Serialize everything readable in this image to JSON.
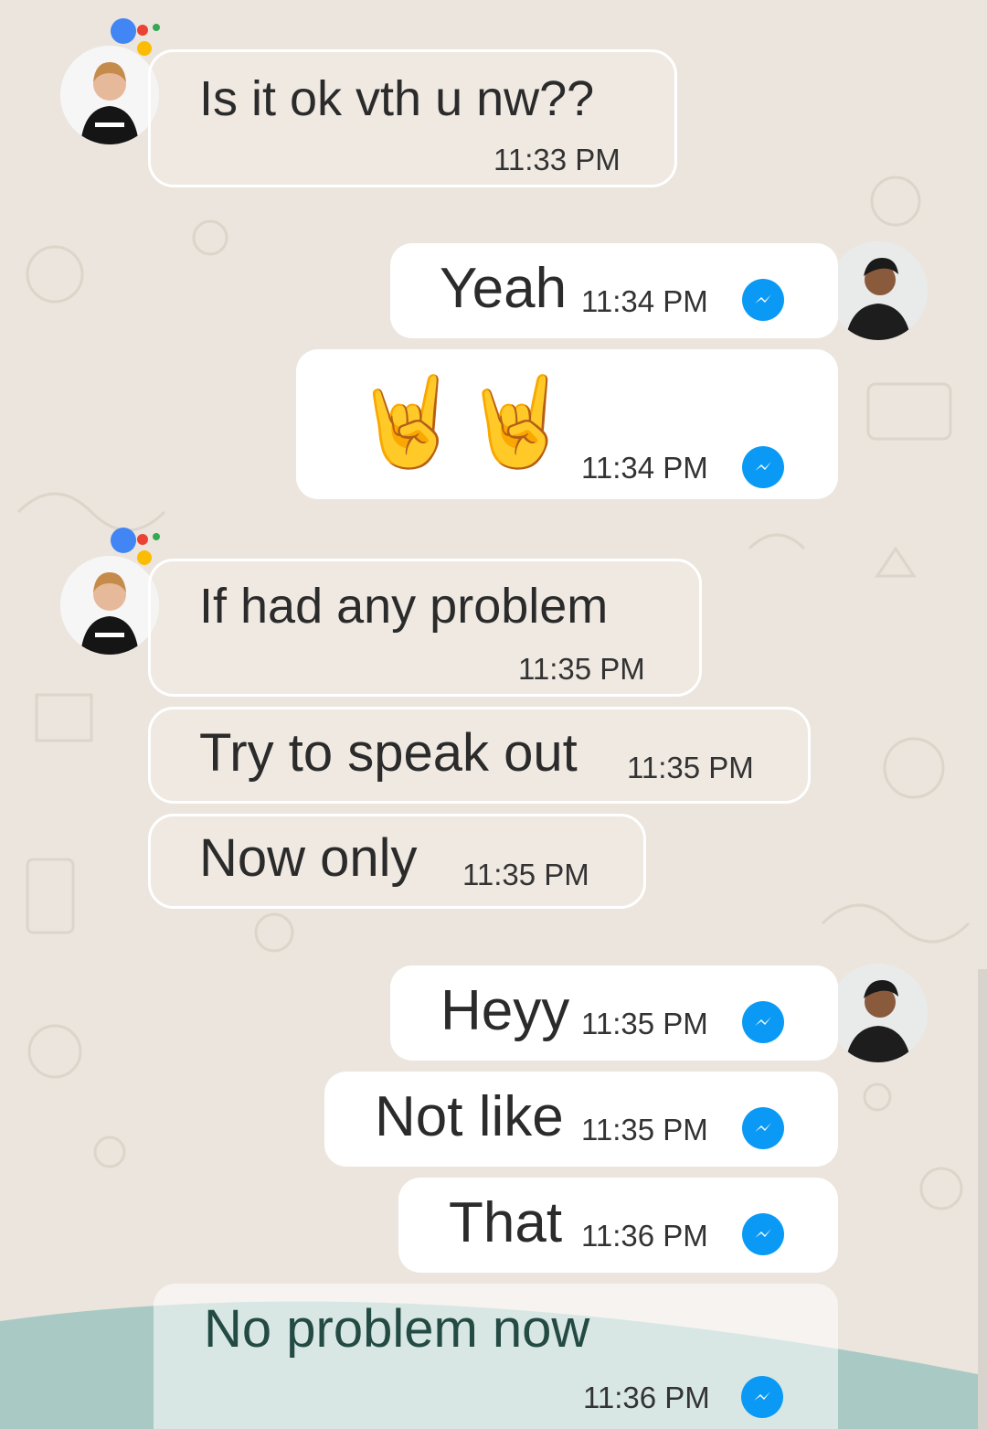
{
  "messages": [
    {
      "text": "Is it ok vth u nw??",
      "time": "11:33 PM",
      "direction": "incoming"
    },
    {
      "text": "Yeah",
      "time": "11:34 PM",
      "direction": "outgoing"
    },
    {
      "text": "🤘🤘",
      "time": "11:34 PM",
      "direction": "outgoing"
    },
    {
      "text": "If had any problem",
      "time": "11:35 PM",
      "direction": "incoming"
    },
    {
      "text": "Try to speak out",
      "time": "11:35 PM",
      "direction": "incoming"
    },
    {
      "text": "Now only",
      "time": "11:35 PM",
      "direction": "incoming"
    },
    {
      "text": "Heyy",
      "time": "11:35 PM",
      "direction": "outgoing"
    },
    {
      "text": "Not like",
      "time": "11:35 PM",
      "direction": "outgoing"
    },
    {
      "text": "That",
      "time": "11:36 PM",
      "direction": "outgoing"
    },
    {
      "text": "No problem now",
      "time": "11:36 PM",
      "direction": "outgoing"
    }
  ],
  "icons": {
    "sent_status": "messenger-bolt-icon",
    "assistant": "google-assistant-dots-icon"
  },
  "colors": {
    "background": "#ece5dd",
    "outgoing_bubble": "#ffffff",
    "status_check": "#0a9af5",
    "bottom_wave": "#a9c9c4",
    "assistant_blue": "#4285f4",
    "assistant_red": "#ea4335",
    "assistant_yellow": "#fbbc05",
    "assistant_green": "#34a853"
  }
}
